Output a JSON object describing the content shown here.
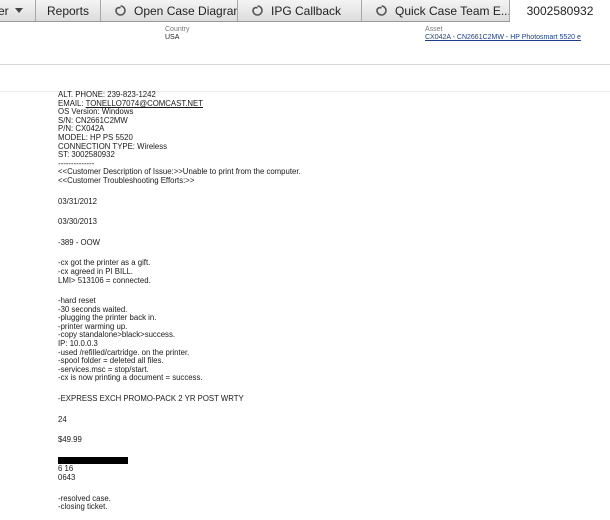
{
  "tabs": [
    {
      "label": "er"
    },
    {
      "label": "Reports"
    },
    {
      "label": "Open Case Diagram"
    },
    {
      "label": "IPG Callback"
    },
    {
      "label": "Quick Case Team E..."
    },
    {
      "label": "3002580932"
    }
  ],
  "info": {
    "country_label": "Country",
    "country_value": "USA",
    "asset_label": "Asset",
    "asset_value": "CX042A - CN2661C2MW - HP Photosmart 5520 e"
  },
  "note": {
    "alt_phone": "ALT. PHONE: 239-823-1242",
    "email_prefix": "EMAIL: ",
    "email": "TONELLO7074@COMCAST.NET",
    "os": "OS Version: Windows",
    "sn": "S/N: CN2661C2MW",
    "pn": "P/N: CX042A",
    "model": "MODEL: HP PS 5520",
    "connection": "CONNECTION TYPE: Wireless",
    "st": "ST: 3002580932",
    "sep": "--------------",
    "desc": "<<Customer Description of Issue:>>Unable to print from the computer.",
    "troubleshooting": "<<Customer Troubleshooting Efforts:>>",
    "date1": "03/31/2012",
    "date2": "03/30/2013",
    "code": "-389 - OOW",
    "gift": "-cx got the printer as a gift.",
    "bill": "-cx agreed in PI BILL.",
    "lmi": "LMI> 513106 = connected.",
    "steps": [
      "-hard reset",
      "-30 seconds waited.",
      "-plugging the printer back in.",
      "-printer warming up.",
      "-copy standalone>black>success.",
      "IP: 10.0.0.3",
      "-used /refilled/cartridge. on the printer.",
      "-spool folder = deleted all files.",
      "-services.msc = stop/start.",
      "-cx is now printing a document = success."
    ],
    "promo": "-EXPRESS EXCH PROMO-PACK 2 YR POST WRTY",
    "qty": "24",
    "price": "$49.99",
    "exp": "6 16",
    "cvv": "0643",
    "resolved": "-resolved case.",
    "closing": "-closing ticket."
  }
}
